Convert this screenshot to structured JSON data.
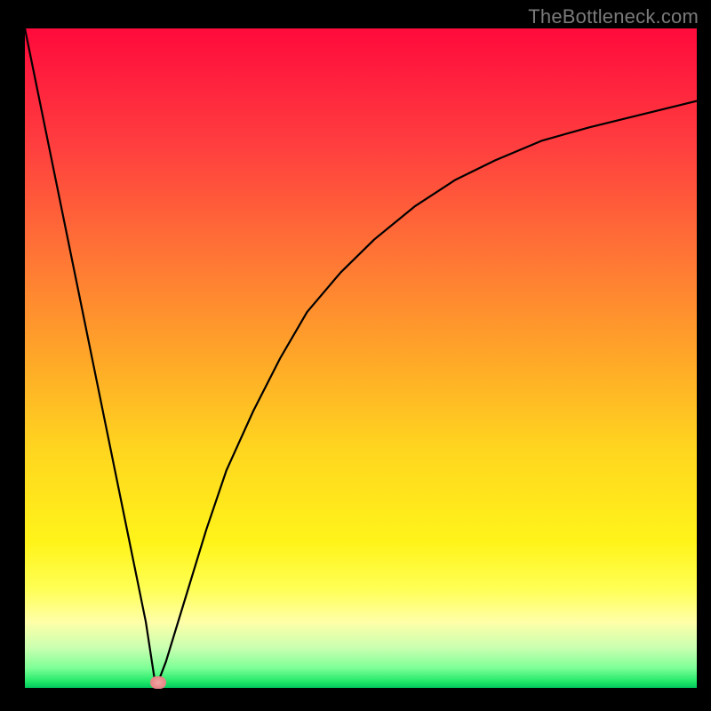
{
  "watermark": "TheBottleneck.com",
  "chart_data": {
    "type": "line",
    "title": "",
    "xlabel": "",
    "ylabel": "",
    "xlim": [
      0,
      100
    ],
    "ylim": [
      0,
      100
    ],
    "grid": false,
    "legend": false,
    "series": [
      {
        "name": "bottleneck-curve",
        "x": [
          0,
          3,
          6,
          9,
          12,
          15,
          18,
          19.5,
          21,
          24,
          27,
          30,
          34,
          38,
          42,
          47,
          52,
          58,
          64,
          70,
          77,
          84,
          92,
          100
        ],
        "values": [
          100,
          85,
          70,
          55,
          40,
          25,
          10,
          0,
          4,
          14,
          24,
          33,
          42,
          50,
          57,
          63,
          68,
          73,
          77,
          80,
          83,
          85,
          87,
          89
        ]
      }
    ],
    "marker": {
      "x": 19.8,
      "y": 0.8,
      "name": "optimal-point"
    },
    "background_gradient": {
      "stops": [
        {
          "pos": 0.0,
          "color": "#ff0a3c"
        },
        {
          "pos": 0.18,
          "color": "#ff3f3f"
        },
        {
          "pos": 0.36,
          "color": "#ff7a34"
        },
        {
          "pos": 0.5,
          "color": "#ffa728"
        },
        {
          "pos": 0.64,
          "color": "#ffd61f"
        },
        {
          "pos": 0.78,
          "color": "#fff41a"
        },
        {
          "pos": 0.85,
          "color": "#ffff55"
        },
        {
          "pos": 0.9,
          "color": "#ffffa8"
        },
        {
          "pos": 0.94,
          "color": "#c8ffb0"
        },
        {
          "pos": 0.97,
          "color": "#7dff96"
        },
        {
          "pos": 0.99,
          "color": "#22e96a"
        },
        {
          "pos": 1.0,
          "color": "#02c85c"
        }
      ]
    }
  }
}
